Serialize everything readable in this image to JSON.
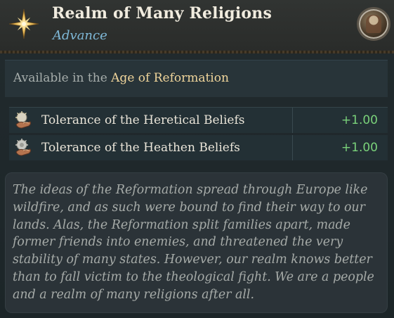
{
  "header": {
    "title": "Realm of Many Religions",
    "subtitle": "Advance",
    "icon": "gold-star-icon",
    "avatar_icon": "ruler-portrait-icon"
  },
  "requirement": {
    "prefix": "Available in the ",
    "age": "Age of Reformation"
  },
  "effects": [
    {
      "label": "Tolerance of the Heretical Beliefs",
      "value": "+1.00",
      "icon": "heretic-tolerance-icon"
    },
    {
      "label": "Tolerance of the Heathen Beliefs",
      "value": "+1.00",
      "icon": "heathen-tolerance-icon"
    }
  ],
  "flavor_text": "The ideas of the Reformation spread through Europe like wildfire, and as such were bound to find their way to our lands. Alas, the Reformation split families apart, made former friends into enemies, and threatened the very stability of many states. However, our realm knows better than to fall victim to the theological fight. We are a people and a realm of many religions after all.",
  "colors": {
    "title": "#f1ecdf",
    "subtitle": "#7fb9d8",
    "highlight": "#f0d59b",
    "positive_value": "#7ad27a"
  }
}
